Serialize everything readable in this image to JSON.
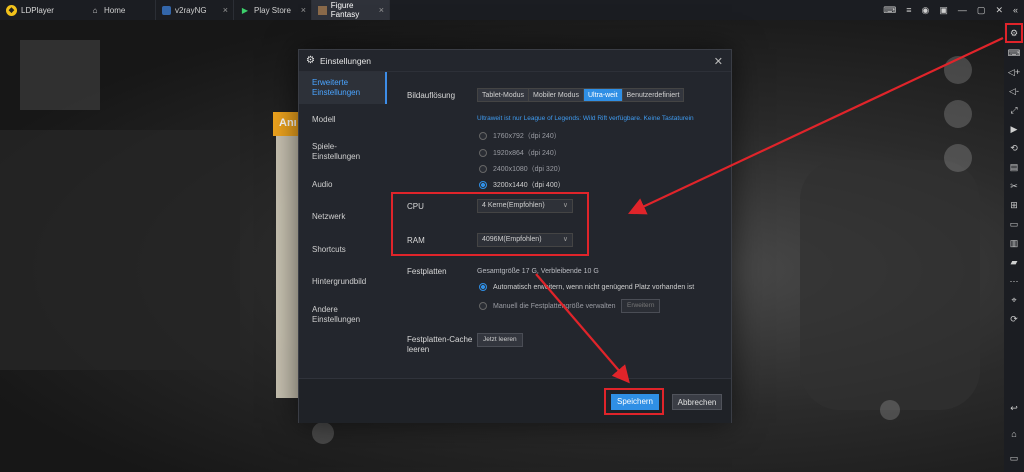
{
  "app": {
    "name": "LDPlayer"
  },
  "tabs": [
    {
      "label": "Home",
      "icon": "home-icon"
    },
    {
      "label": "v2rayNG",
      "icon": "app-icon"
    },
    {
      "label": "Play Store",
      "icon": "play-store-icon"
    },
    {
      "label": "Figure Fantasy",
      "icon": "game-icon"
    }
  ],
  "game": {
    "banner_text": "Anı"
  },
  "dialog": {
    "title": "Einstellungen",
    "nav": [
      "Erweiterte Einstellungen",
      "Modell",
      "Spiele-Einstellungen",
      "Audio",
      "Netzwerk",
      "Shortcuts",
      "Hintergrundbild",
      "Andere Einstellungen"
    ],
    "resolution": {
      "label": "Bildauflösung",
      "modes": [
        "Tablet-Modus",
        "Mobiler Modus",
        "Ultra-weit",
        "Benutzerdefiniert"
      ],
      "active_mode": "Ultra-weit",
      "info": "Ultraweit ist nur League of Legends: Wild Rift verfügbare. Keine Tastaturein",
      "options": [
        "1760x792（dpi 240）",
        "1920x864（dpi 240）",
        "2400x1080（dpi 320）",
        "3200x1440（dpi 400）"
      ],
      "selected": "3200x1440（dpi 400）"
    },
    "cpu": {
      "label": "CPU",
      "value": "4 Kerne(Empfohlen)"
    },
    "ram": {
      "label": "RAM",
      "value": "4096M(Empfohlen)"
    },
    "disk": {
      "label": "Festplatten",
      "summary": "Gesamtgröße 17 G,  Verbleibende 10 G",
      "option_auto": "Automatisch erweitern, wenn nicht genügend Platz vorhanden ist",
      "option_manual": "Manuell die Festplattengröße verwalten",
      "expand_button": "Erweitern"
    },
    "cache": {
      "label": "Festplatten-Cache leeren",
      "button": "Jetzt leeren"
    },
    "save": "Speichern",
    "cancel": "Abbrechen"
  },
  "colors": {
    "accent": "#2f8fe5",
    "annotation_red": "#e0242a"
  }
}
